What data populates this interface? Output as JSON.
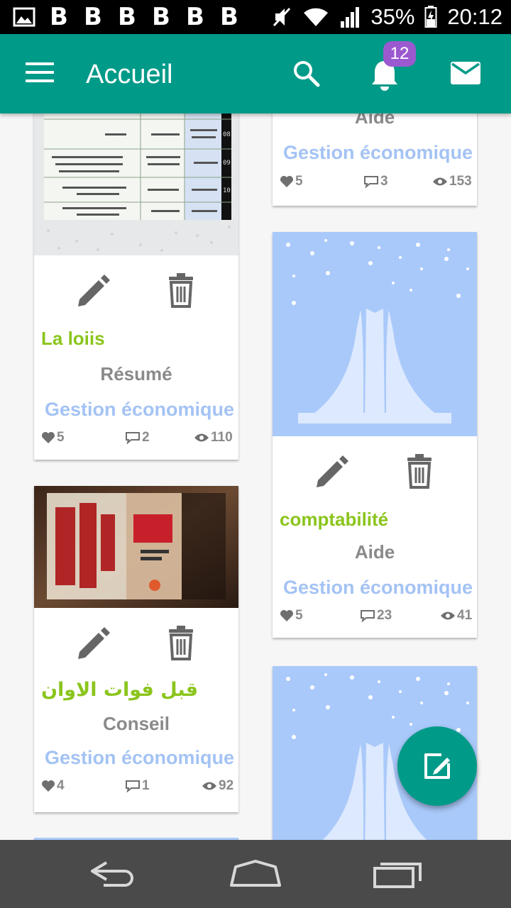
{
  "status_bar": {
    "notification_letters": [
      "B",
      "B",
      "B",
      "B",
      "B",
      "B"
    ],
    "battery": "35%",
    "time": "20:12"
  },
  "app_bar": {
    "title": "Accueil",
    "notification_count": "12"
  },
  "cards": [
    {
      "title": "",
      "type": "Aide",
      "category": "Gestion économique",
      "likes": "5",
      "comments": "3",
      "views": "153"
    },
    {
      "title": "La  loiis",
      "type": "Résumé",
      "category": "Gestion économique",
      "likes": "5",
      "comments": "2",
      "views": "110"
    },
    {
      "title": "comptabilité",
      "type": "Aide",
      "category": "Gestion économique",
      "likes": "5",
      "comments": "23",
      "views": "41"
    },
    {
      "title": "قبل فوات الاوان",
      "type": "Conseil",
      "category": "Gestion économique",
      "likes": "4",
      "comments": "1",
      "views": "92"
    }
  ],
  "colors": {
    "primary": "#009a88",
    "badge": "#9b59d0",
    "title_green": "#8bc51d",
    "category_blue": "#a4c3f4",
    "muted_text": "#8a8a8a",
    "nav_bar": "#4a4a4a"
  },
  "icons": {
    "menu": "menu-icon",
    "search": "search-icon",
    "notifications": "bell-icon",
    "messages": "mail-icon",
    "edit": "pencil-icon",
    "delete": "trash-icon",
    "likes": "heart-icon",
    "comments": "comment-icon",
    "views": "eye-icon",
    "compose": "compose-icon"
  }
}
